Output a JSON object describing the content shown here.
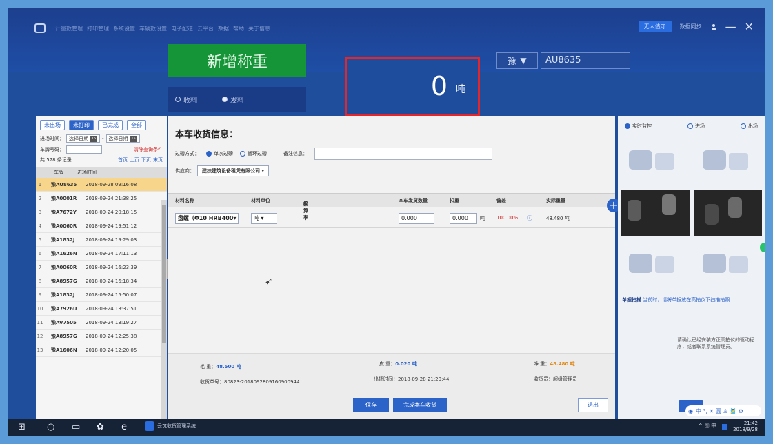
{
  "titlebar": {
    "menu": [
      "计量数管理",
      "打印管理",
      "系统设置",
      "车辆数设置",
      "电子配送",
      "云平台",
      "数据",
      "帮助",
      "关于信息"
    ],
    "unattended": "无人值守",
    "sync": "数据同步",
    "user_icon": "person-icon",
    "minimize": "—",
    "close": "✕"
  },
  "weighing": {
    "new_button": "新增称重",
    "mode_receive": "收料",
    "mode_send": "发料",
    "weight": "0",
    "unit": "吨",
    "plate_province": "豫",
    "plate_number": "AU8635"
  },
  "left": {
    "filters": [
      "未出场",
      "未打印",
      "已完成",
      "全部"
    ],
    "entry_time_label": "进场时间：",
    "date_placeholder": "选择日期",
    "date_sep": "-",
    "plate_label": "车牌号码：",
    "clear_link": "清除查询条件",
    "record_count": "共 578 条记录",
    "pager": [
      "首页",
      "上页",
      "下页",
      "末页"
    ],
    "col_plate": "车牌",
    "col_time": "进场时间",
    "rows": [
      {
        "n": "1",
        "plate": "豫AU8635",
        "time": "2018-09-28 09:16:08"
      },
      {
        "n": "2",
        "plate": "豫A0001R",
        "time": "2018-09-24 21:38:25"
      },
      {
        "n": "3",
        "plate": "豫A7672Y",
        "time": "2018-09-24 20:18:15"
      },
      {
        "n": "4",
        "plate": "豫A0060R",
        "time": "2018-09-24 19:51:12"
      },
      {
        "n": "5",
        "plate": "豫A1832J",
        "time": "2018-09-24 19:29:03"
      },
      {
        "n": "6",
        "plate": "豫A1626N",
        "time": "2018-09-24 17:11:13"
      },
      {
        "n": "7",
        "plate": "豫A0060R",
        "time": "2018-09-24 16:23:39"
      },
      {
        "n": "8",
        "plate": "豫A8957G",
        "time": "2018-09-24 16:18:34"
      },
      {
        "n": "9",
        "plate": "豫A1832J",
        "time": "2018-09-24 15:50:07"
      },
      {
        "n": "10",
        "plate": "豫A7926U",
        "time": "2018-09-24 13:37:51"
      },
      {
        "n": "11",
        "plate": "豫AV7505",
        "time": "2018-09-24 13:19:27"
      },
      {
        "n": "12",
        "plate": "豫A8957G",
        "time": "2018-09-24 12:25:38"
      },
      {
        "n": "13",
        "plate": "豫A1606N",
        "time": "2018-09-24 12:20:05"
      }
    ]
  },
  "main": {
    "title": "本车收货信息：",
    "method_label": "过磅方式：",
    "method_single": "单次过磅",
    "method_cycle": "循环过磅",
    "remark_label": "备注信息：",
    "supplier_label": "供应商：",
    "supplier_value": "建扶建筑设备租凭有限公司",
    "columns": [
      "材料名称",
      "材料单位",
      "换算率",
      "本车发货数量",
      "扣重",
      "偏差",
      "实际重量"
    ],
    "row": {
      "material": "盘螺（Φ10 HRB400",
      "unit": "吨",
      "quantity": "0.000",
      "deduct": "0.000",
      "deduct_unit": "吨",
      "deviation": "100.00%",
      "actual": "48.480 吨"
    },
    "gross_label": "毛 重：",
    "gross_value": "48.500 吨",
    "tare_label": "皮 重：",
    "tare_value": "0.020 吨",
    "net_label": "净 重：",
    "net_value": "48.480 吨",
    "receipt_label": "收货单号：",
    "receipt_value": "80823-201809280916090094​4",
    "exit_time_label": "出场时间：",
    "exit_time_value": "2018-09-28 21:20:44",
    "receiver_label": "收货员：",
    "receiver_value": "超级管理员",
    "save_button": "保存",
    "finish_button": "完成本车收货",
    "exit_button": "退出"
  },
  "right": {
    "tab_live": "实时监控",
    "tab_enter": "进场",
    "tab_exit": "出场",
    "scan_label": "单据扫描",
    "scan_hint": "当前时，请将单据放在高拍仪下扫描拍照",
    "notice": "请确认已经安装方正高拍仪的驱动程序，或者联系系统管理员。",
    "ime": "中 °, ✕ 圆 ♙ 🎽 ⚙"
  },
  "taskbar": {
    "app_name": "云筑收货管理系统",
    "tray": "^ 🖫 中",
    "time": "21:42",
    "date": "2018/9/28"
  }
}
